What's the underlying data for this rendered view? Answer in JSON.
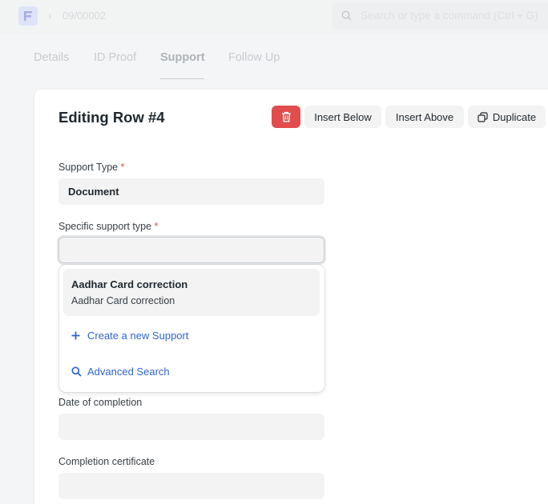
{
  "navbar": {
    "breadcrumb_sep": "›",
    "breadcrumb": "09/00002",
    "search_placeholder": "Search or type a command (Ctrl + G)"
  },
  "tabs": [
    {
      "label": "Details"
    },
    {
      "label": "ID Proof"
    },
    {
      "label": "Support",
      "active": true
    },
    {
      "label": "Follow Up"
    }
  ],
  "editor": {
    "title": "Editing Row #4",
    "insert_below_label": "Insert Below",
    "insert_above_label": "Insert Above",
    "duplicate_label": "Duplicate"
  },
  "form": {
    "support_type_label": "Support Type",
    "support_type_value": "Document",
    "specific_label": "Specific support type",
    "specific_value": "",
    "required_mark": "*",
    "date_label": "Date of completion",
    "date_value": "",
    "certificate_label": "Completion certificate",
    "certificate_value": ""
  },
  "dropdown": {
    "option_title": "Aadhar Card correction",
    "option_subtitle": "Aadhar Card correction",
    "create_label": "Create a new Support",
    "advanced_label": "Advanced Search"
  },
  "colors": {
    "danger": "#e24c4c",
    "link": "#2f66d0",
    "field_bg": "#f3f3f3"
  }
}
